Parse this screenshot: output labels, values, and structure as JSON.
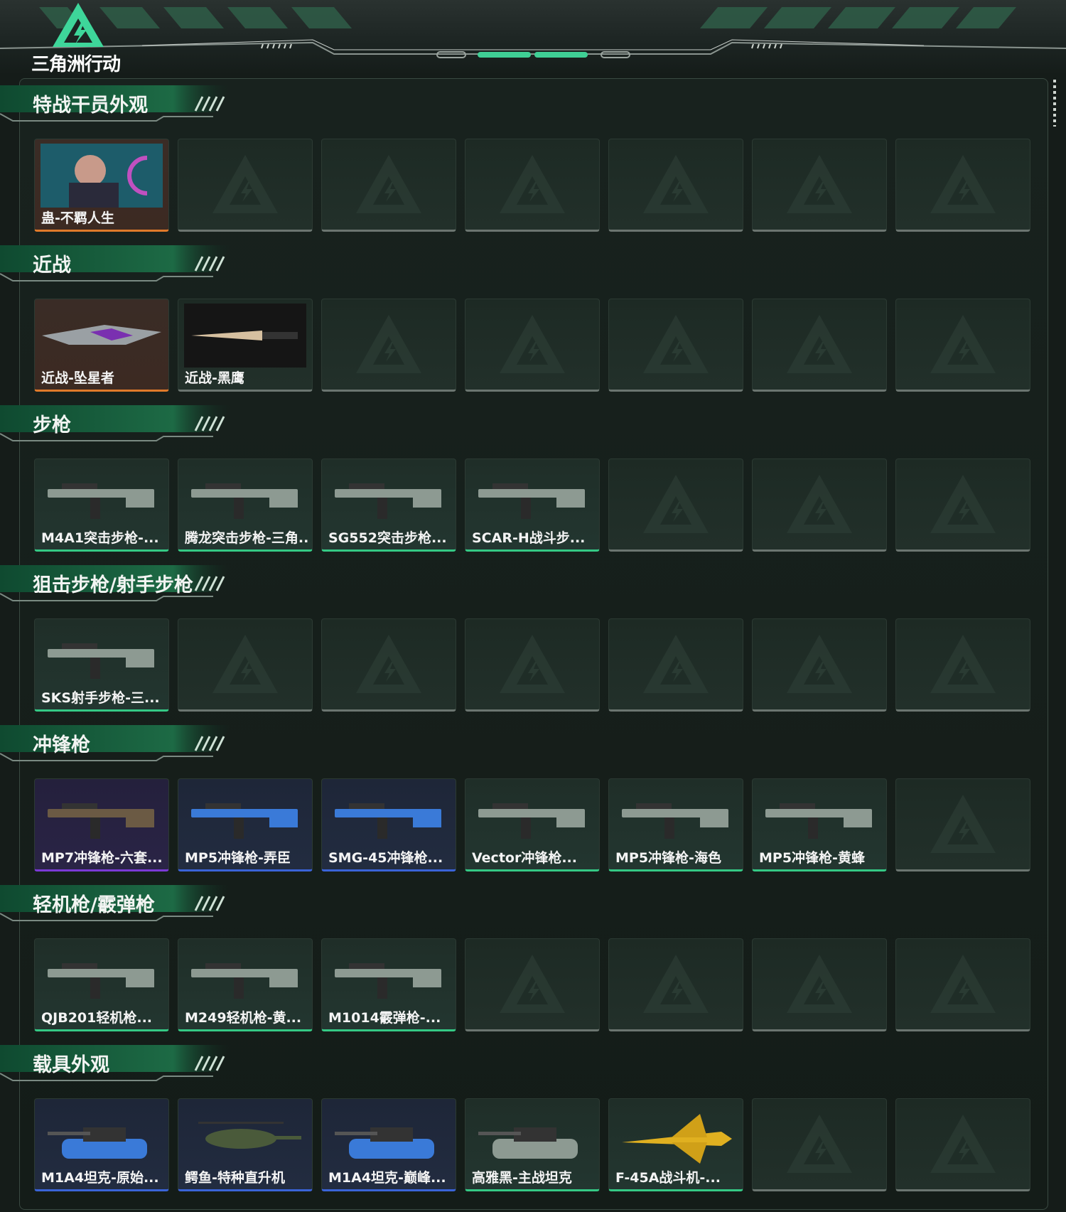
{
  "app": {
    "logo_text": "三角洲行动"
  },
  "colors": {
    "accent_green": "#35c985",
    "orange": "#e07a2a",
    "purple": "#7b3ad6",
    "blue": "#3a64d8",
    "empty": "#6b7570"
  },
  "categories": [
    {
      "title": "特战干员外观",
      "items": [
        {
          "label": "蛊-不羁人生",
          "rarity": "orange",
          "icon": "operator-portrait-icon"
        },
        null,
        null,
        null,
        null,
        null,
        null
      ]
    },
    {
      "title": "近战",
      "items": [
        {
          "label": "近战-坠星者",
          "rarity": "orange",
          "icon": "melee-blade-icon"
        },
        {
          "label": "近战-黑鹰",
          "rarity": "none",
          "icon": "knife-icon"
        },
        null,
        null,
        null,
        null,
        null
      ]
    },
    {
      "title": "步枪",
      "items": [
        {
          "label": "M4A1突击步枪-...",
          "rarity": "green",
          "icon": "rifle-icon"
        },
        {
          "label": "腾龙突击步枪-三角...",
          "rarity": "green",
          "icon": "rifle-icon"
        },
        {
          "label": "SG552突击步枪...",
          "rarity": "green",
          "icon": "rifle-icon"
        },
        {
          "label": "SCAR-H战斗步...",
          "rarity": "green",
          "icon": "rifle-icon"
        },
        null,
        null,
        null
      ]
    },
    {
      "title": "狙击步枪/射手步枪",
      "items": [
        {
          "label": "SKS射手步枪-三...",
          "rarity": "green",
          "icon": "marksman-rifle-icon"
        },
        null,
        null,
        null,
        null,
        null,
        null
      ]
    },
    {
      "title": "冲锋枪",
      "items": [
        {
          "label": "MP7冲锋枪-六套...",
          "rarity": "purple",
          "icon": "smg-icon"
        },
        {
          "label": "MP5冲锋枪-弄臣",
          "rarity": "blue",
          "icon": "smg-icon"
        },
        {
          "label": "SMG-45冲锋枪...",
          "rarity": "blue",
          "icon": "smg-icon"
        },
        {
          "label": "Vector冲锋枪...",
          "rarity": "green",
          "icon": "smg-icon"
        },
        {
          "label": "MP5冲锋枪-海色",
          "rarity": "green",
          "icon": "smg-icon"
        },
        {
          "label": "MP5冲锋枪-黄蜂",
          "rarity": "green",
          "icon": "smg-icon"
        },
        null
      ]
    },
    {
      "title": "轻机枪/霰弹枪",
      "items": [
        {
          "label": "QJB201轻机枪...",
          "rarity": "green",
          "icon": "lmg-icon"
        },
        {
          "label": "M249轻机枪-黄...",
          "rarity": "green",
          "icon": "lmg-icon"
        },
        {
          "label": "M1014霰弹枪-...",
          "rarity": "green",
          "icon": "shotgun-icon"
        },
        null,
        null,
        null,
        null
      ]
    },
    {
      "title": "载具外观",
      "items": [
        {
          "label": "M1A4坦克-原始...",
          "rarity": "blue",
          "icon": "tank-icon"
        },
        {
          "label": "鳄鱼-特种直升机",
          "rarity": "blue",
          "icon": "helicopter-icon"
        },
        {
          "label": "M1A4坦克-巅峰...",
          "rarity": "blue",
          "icon": "tank-icon"
        },
        {
          "label": "高雅黑-主战坦克",
          "rarity": "green",
          "icon": "tank-icon"
        },
        {
          "label": "F-45A战斗机-...",
          "rarity": "green",
          "icon": "jet-icon"
        },
        null,
        null
      ]
    }
  ]
}
